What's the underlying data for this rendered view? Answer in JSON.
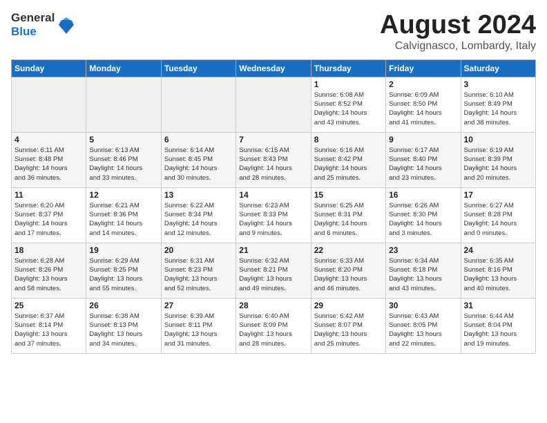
{
  "header": {
    "logo_line1": "General",
    "logo_line2": "Blue",
    "month": "August 2024",
    "location": "Calvignasco, Lombardy, Italy"
  },
  "weekdays": [
    "Sunday",
    "Monday",
    "Tuesday",
    "Wednesday",
    "Thursday",
    "Friday",
    "Saturday"
  ],
  "weeks": [
    [
      {
        "day": "",
        "info": ""
      },
      {
        "day": "",
        "info": ""
      },
      {
        "day": "",
        "info": ""
      },
      {
        "day": "",
        "info": ""
      },
      {
        "day": "1",
        "info": "Sunrise: 6:08 AM\nSunset: 8:52 PM\nDaylight: 14 hours\nand 43 minutes."
      },
      {
        "day": "2",
        "info": "Sunrise: 6:09 AM\nSunset: 8:50 PM\nDaylight: 14 hours\nand 41 minutes."
      },
      {
        "day": "3",
        "info": "Sunrise: 6:10 AM\nSunset: 8:49 PM\nDaylight: 14 hours\nand 38 minutes."
      }
    ],
    [
      {
        "day": "4",
        "info": "Sunrise: 6:11 AM\nSunset: 8:48 PM\nDaylight: 14 hours\nand 36 minutes."
      },
      {
        "day": "5",
        "info": "Sunrise: 6:13 AM\nSunset: 8:46 PM\nDaylight: 14 hours\nand 33 minutes."
      },
      {
        "day": "6",
        "info": "Sunrise: 6:14 AM\nSunset: 8:45 PM\nDaylight: 14 hours\nand 30 minutes."
      },
      {
        "day": "7",
        "info": "Sunrise: 6:15 AM\nSunset: 8:43 PM\nDaylight: 14 hours\nand 28 minutes."
      },
      {
        "day": "8",
        "info": "Sunrise: 6:16 AM\nSunset: 8:42 PM\nDaylight: 14 hours\nand 25 minutes."
      },
      {
        "day": "9",
        "info": "Sunrise: 6:17 AM\nSunset: 8:40 PM\nDaylight: 14 hours\nand 23 minutes."
      },
      {
        "day": "10",
        "info": "Sunrise: 6:19 AM\nSunset: 8:39 PM\nDaylight: 14 hours\nand 20 minutes."
      }
    ],
    [
      {
        "day": "11",
        "info": "Sunrise: 6:20 AM\nSunset: 8:37 PM\nDaylight: 14 hours\nand 17 minutes."
      },
      {
        "day": "12",
        "info": "Sunrise: 6:21 AM\nSunset: 8:36 PM\nDaylight: 14 hours\nand 14 minutes."
      },
      {
        "day": "13",
        "info": "Sunrise: 6:22 AM\nSunset: 8:34 PM\nDaylight: 14 hours\nand 12 minutes."
      },
      {
        "day": "14",
        "info": "Sunrise: 6:23 AM\nSunset: 8:33 PM\nDaylight: 14 hours\nand 9 minutes."
      },
      {
        "day": "15",
        "info": "Sunrise: 6:25 AM\nSunset: 8:31 PM\nDaylight: 14 hours\nand 6 minutes."
      },
      {
        "day": "16",
        "info": "Sunrise: 6:26 AM\nSunset: 8:30 PM\nDaylight: 14 hours\nand 3 minutes."
      },
      {
        "day": "17",
        "info": "Sunrise: 6:27 AM\nSunset: 8:28 PM\nDaylight: 14 hours\nand 0 minutes."
      }
    ],
    [
      {
        "day": "18",
        "info": "Sunrise: 6:28 AM\nSunset: 8:26 PM\nDaylight: 13 hours\nand 58 minutes."
      },
      {
        "day": "19",
        "info": "Sunrise: 6:29 AM\nSunset: 8:25 PM\nDaylight: 13 hours\nand 55 minutes."
      },
      {
        "day": "20",
        "info": "Sunrise: 6:31 AM\nSunset: 8:23 PM\nDaylight: 13 hours\nand 52 minutes."
      },
      {
        "day": "21",
        "info": "Sunrise: 6:32 AM\nSunset: 8:21 PM\nDaylight: 13 hours\nand 49 minutes."
      },
      {
        "day": "22",
        "info": "Sunrise: 6:33 AM\nSunset: 8:20 PM\nDaylight: 13 hours\nand 46 minutes."
      },
      {
        "day": "23",
        "info": "Sunrise: 6:34 AM\nSunset: 8:18 PM\nDaylight: 13 hours\nand 43 minutes."
      },
      {
        "day": "24",
        "info": "Sunrise: 6:35 AM\nSunset: 8:16 PM\nDaylight: 13 hours\nand 40 minutes."
      }
    ],
    [
      {
        "day": "25",
        "info": "Sunrise: 6:37 AM\nSunset: 8:14 PM\nDaylight: 13 hours\nand 37 minutes."
      },
      {
        "day": "26",
        "info": "Sunrise: 6:38 AM\nSunset: 8:13 PM\nDaylight: 13 hours\nand 34 minutes."
      },
      {
        "day": "27",
        "info": "Sunrise: 6:39 AM\nSunset: 8:11 PM\nDaylight: 13 hours\nand 31 minutes."
      },
      {
        "day": "28",
        "info": "Sunrise: 6:40 AM\nSunset: 8:09 PM\nDaylight: 13 hours\nand 28 minutes."
      },
      {
        "day": "29",
        "info": "Sunrise: 6:42 AM\nSunset: 8:07 PM\nDaylight: 13 hours\nand 25 minutes."
      },
      {
        "day": "30",
        "info": "Sunrise: 6:43 AM\nSunset: 8:05 PM\nDaylight: 13 hours\nand 22 minutes."
      },
      {
        "day": "31",
        "info": "Sunrise: 6:44 AM\nSunset: 8:04 PM\nDaylight: 13 hours\nand 19 minutes."
      }
    ]
  ]
}
